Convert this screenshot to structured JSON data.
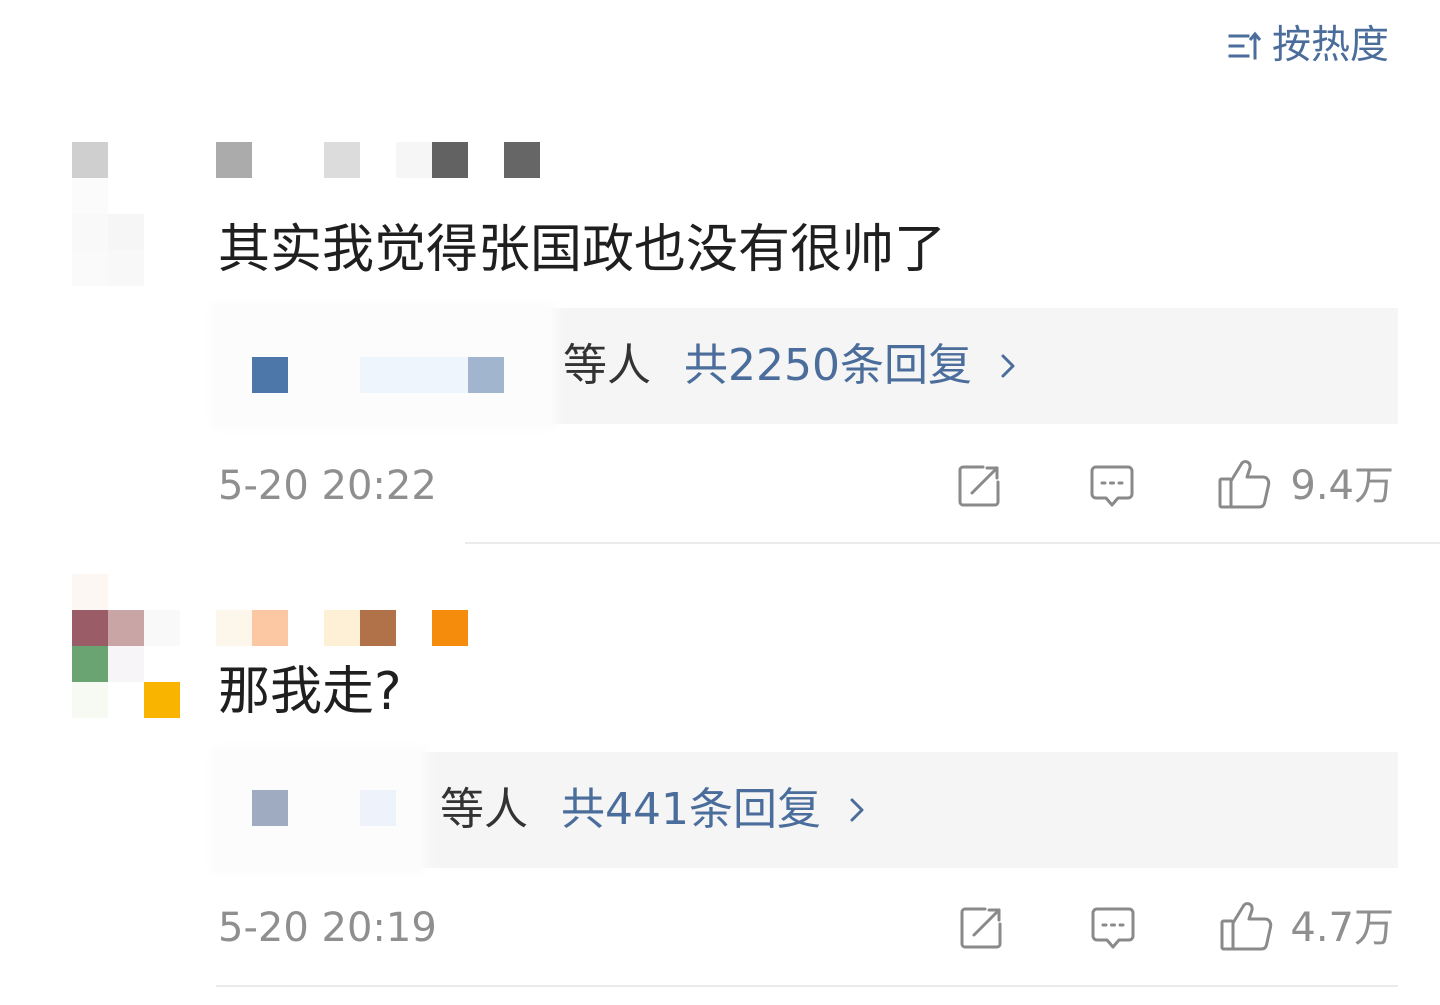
{
  "sort": {
    "label": "按热度",
    "icon": "sort-icon"
  },
  "comments": [
    {
      "text": "其实我觉得张国政也没有很帅了",
      "reply_summary": {
        "suffix": "等人",
        "count_label": "共2250条回复",
        "icon": "chevron-right-icon"
      },
      "time": "5-20 20:22",
      "likes": "9.4万"
    },
    {
      "text": "那我走?",
      "reply_summary": {
        "suffix": "等人",
        "count_label": "共441条回复",
        "icon": "chevron-right-icon"
      },
      "time": "5-20 20:19",
      "likes": "4.7万"
    }
  ],
  "actions": {
    "share_icon": "share-icon",
    "comment_icon": "comment-icon",
    "like_icon": "thumbs-up-icon"
  },
  "colors": {
    "accent": "#4b6d9b",
    "text": "#1f1f1f",
    "meta": "#8f8f8f",
    "reply_bg": "#f5f5f5",
    "icon": "#8a8a8a",
    "divider": "#ebebeb"
  }
}
